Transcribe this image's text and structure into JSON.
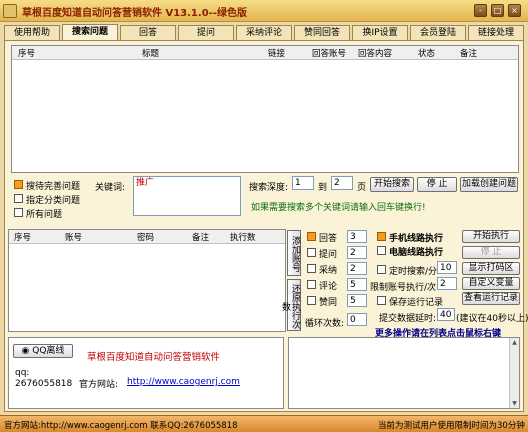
{
  "window": {
    "title": "草根百度知道自动问答营销软件 V13.1.0--绿色版",
    "controls": [
      "-",
      "□",
      "×"
    ]
  },
  "tabs": [
    "使用帮助",
    "搜索问题",
    "回答",
    "提问",
    "采纳评论",
    "赞同回答",
    "换IP设置",
    "会员登陆",
    "链接处理"
  ],
  "active_tab": "搜索问题",
  "questions_table": {
    "columns": [
      "序号",
      "标题",
      "链接",
      "回答账号",
      "回答内容",
      "状态",
      "备注"
    ],
    "rows": []
  },
  "search": {
    "modes": [
      "搜待完善问题",
      "指定分类问题",
      "所有问题"
    ],
    "selected_mode": "搜待完善问题",
    "keyword_label": "关键词:",
    "keyword_value": "推广",
    "depth_label": "搜索深度:",
    "depth_from": "1",
    "depth_to_label": "到",
    "depth_to": "2",
    "depth_unit": "页",
    "start_button": "开始搜索",
    "stop_button": "停 止",
    "load_button": "加载创建问题",
    "hint": "如果需要搜索多个关键词请输入回车键换行!"
  },
  "accounts_table": {
    "columns": [
      "序号",
      "账号",
      "密码",
      "备注",
      "执行数"
    ],
    "rows": []
  },
  "side_buttons": {
    "add_account": "添加账号",
    "exec_count": "还原执行次数"
  },
  "actions": {
    "items": [
      {
        "label": "回答",
        "checked": true,
        "count": "3"
      },
      {
        "label": "提问",
        "checked": false,
        "count": "2"
      },
      {
        "label": "采纳",
        "checked": false,
        "count": "2"
      },
      {
        "label": "评论",
        "checked": false,
        "count": "5"
      },
      {
        "label": "赞同",
        "checked": false,
        "count": "5"
      }
    ],
    "loop_label": "循环次数:",
    "loop_value": "0"
  },
  "options": {
    "mobile_route": "手机线路执行",
    "mobile_checked": true,
    "pc_route": "电脑线路执行",
    "pc_checked": false,
    "timed_search_label": "定时搜索/分",
    "timed_search_value": "10",
    "limit_label": "限制账号执行/次",
    "limit_value": "2",
    "save_log_label": "保存运行记录",
    "delay_label": "提交数据延时:",
    "delay_value": "40",
    "delay_hint": "(建议在40秒以上)",
    "more_hint": "更多操作请在列表点击鼠标右键"
  },
  "right_buttons": [
    "开始执行",
    "停 止",
    "显示打码区",
    "自定义变量",
    "查看运行记录"
  ],
  "info": {
    "qq_button": "QQ离线",
    "product_name": "草根百度知道自动问答营销软件",
    "qq_label": "qq:",
    "qq_number": "2676055818",
    "site_label": "官方网站:",
    "site_url": "http://www.caogenrj.com"
  },
  "status": {
    "left": "官方网站:http://www.caogenrj.com 联系QQ:2676055818",
    "right": "当前为测试用户使用限制时间为30分钟"
  }
}
